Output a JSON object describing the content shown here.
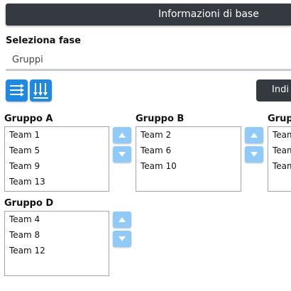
{
  "header": {
    "title": "Informazioni di base"
  },
  "phase": {
    "label": "Seleziona fase",
    "selected": "Gruppi"
  },
  "toolbar": {
    "icons": [
      "list-arrows-icon",
      "columns-down-arrows-icon"
    ],
    "action_label": "Indi"
  },
  "groups": [
    {
      "title": "Gruppo A",
      "teams": [
        "Team 1",
        "Team 5",
        "Team 9",
        "Team 13"
      ]
    },
    {
      "title": "Gruppo B",
      "teams": [
        "Team 2",
        "Team 6",
        "Team 10"
      ]
    },
    {
      "title": "Grup",
      "teams": [
        "Team",
        "Team",
        "Team"
      ]
    },
    {
      "title": "Gruppo D",
      "teams": [
        "Team 4",
        "Team 8",
        "Team 12"
      ]
    }
  ],
  "colors": {
    "header_bg": "#343a40",
    "primary": "#1e88e5",
    "arrow_bg": "#90caf9"
  }
}
